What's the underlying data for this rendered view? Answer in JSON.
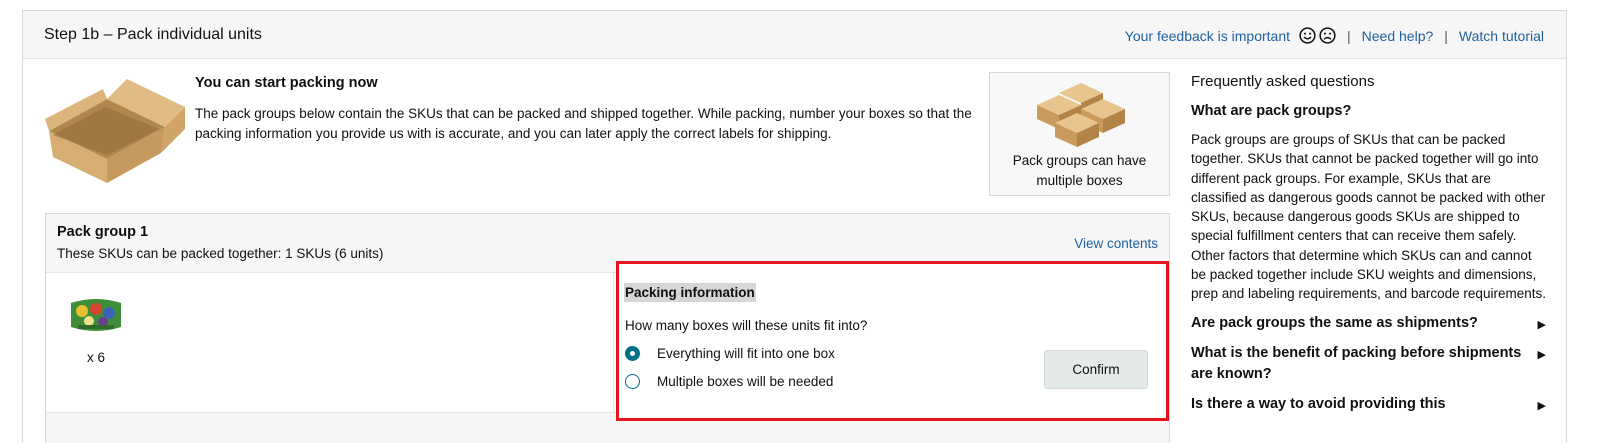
{
  "header": {
    "title": "Step 1b – Pack individual units",
    "feedback": "Your feedback is important",
    "separator": "|",
    "help": "Need help?",
    "tutorial": "Watch tutorial"
  },
  "intro": {
    "title": "You can start packing now",
    "description": "The pack groups below contain the SKUs that can be packed and shipped together. While packing, number your boxes so that the packing information you provide us with is accurate, and you can later apply the correct labels for shipping."
  },
  "pack_groups_card": {
    "text": "Pack groups can have multiple boxes"
  },
  "faq": {
    "title": "Frequently asked questions",
    "expanded_question": "What are pack groups?",
    "expanded_answer": "Pack groups are groups of SKUs that can be packed together. SKUs that cannot be packed together will go into different pack groups. For example, SKUs that are classified as dangerous goods cannot be packed with other SKUs, because dangerous goods SKUs are shipped to special fulfillment centers that can receive them safely. Other factors that determine which SKUs can and cannot be packed together include SKU weights and dimensions, prep and labeling requirements, and barcode requirements.",
    "questions": [
      "Are pack groups the same as shipments?",
      "What is the benefit of packing before shipments are known?",
      "Is there a way to avoid providing this"
    ],
    "arrow_icon": "triangle-right"
  },
  "pack_group": {
    "name": "Pack group 1",
    "subtitle": "These SKUs can be packed together: 1 SKUs (6 units)",
    "view_contents": "View contents",
    "sku": {
      "quantity": "x 6"
    }
  },
  "packing_info": {
    "title": "Packing information",
    "question": "How many boxes will these units fit into?",
    "options": [
      {
        "label": "Everything will fit into one box",
        "selected": true
      },
      {
        "label": "Multiple boxes will be needed",
        "selected": false
      }
    ],
    "confirm": "Confirm"
  },
  "colors": {
    "link": "#2162a1",
    "highlight_border": "#e5151f",
    "radio": "#007185"
  }
}
